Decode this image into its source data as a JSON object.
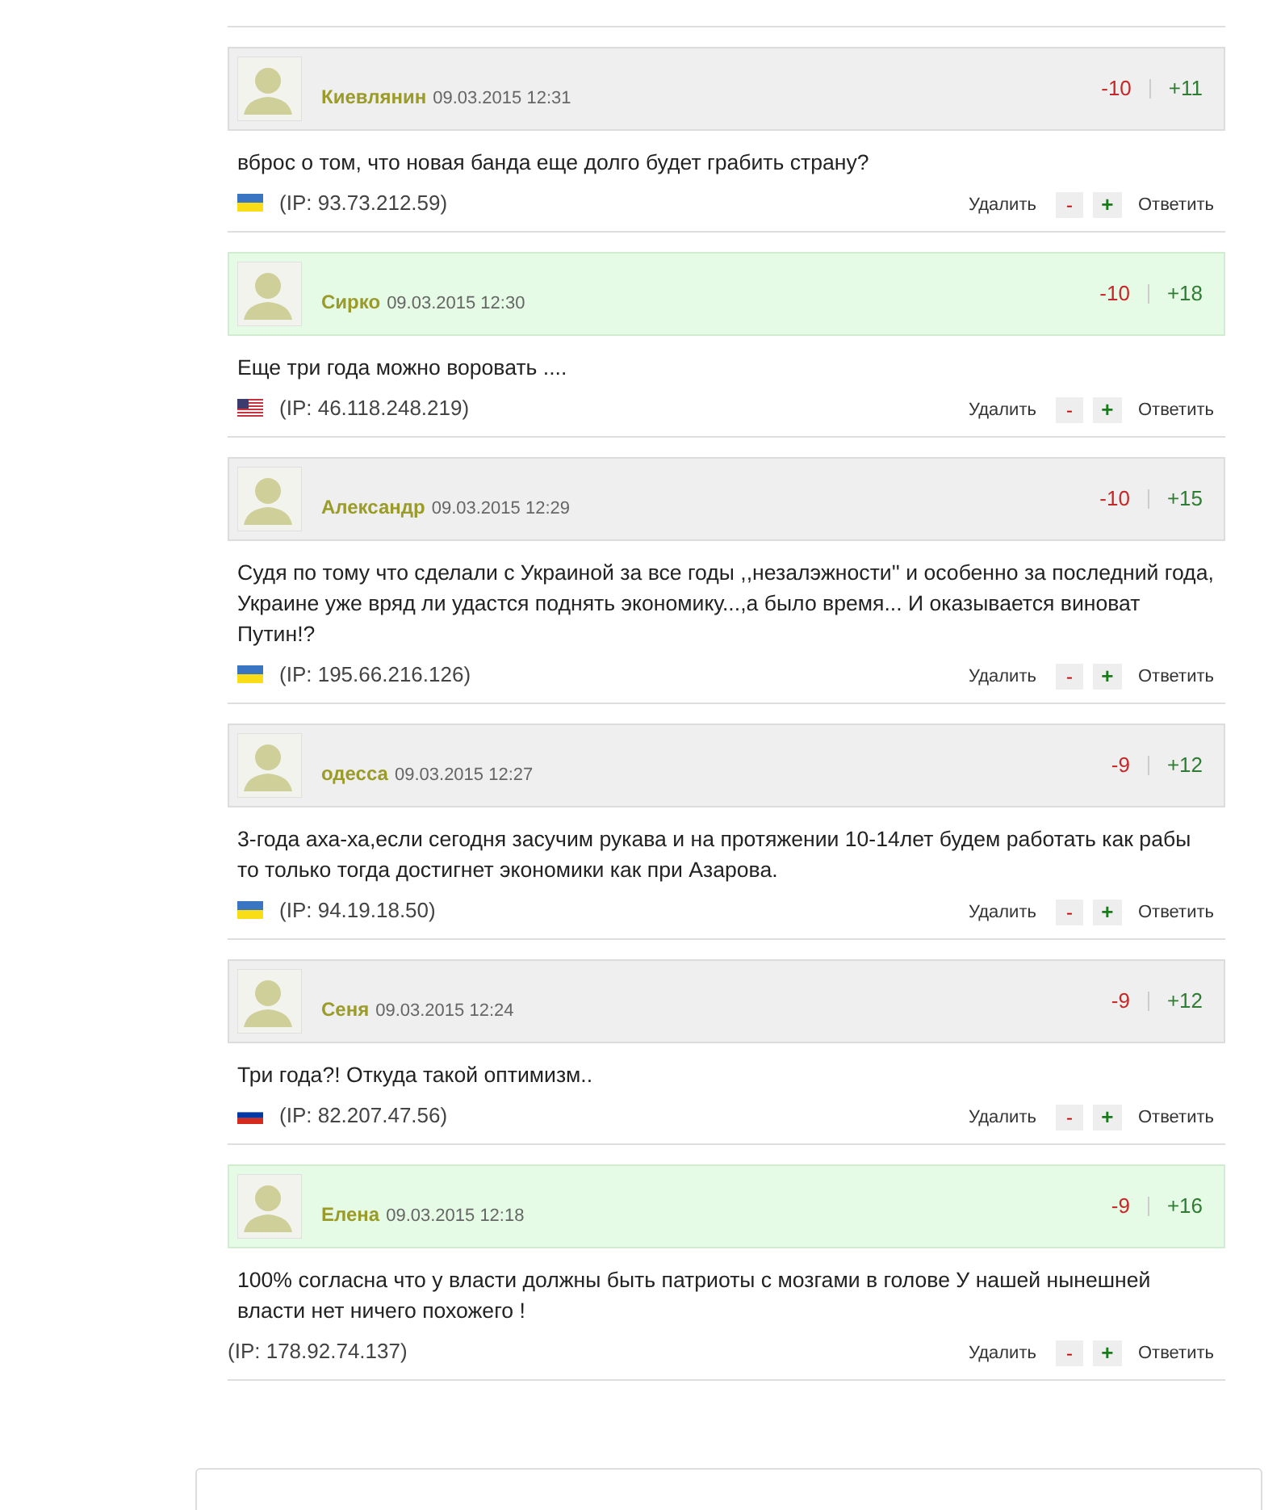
{
  "comments": [
    {
      "name": "Киевлянин",
      "date": "09.03.2015 12:31",
      "down": "-10",
      "up": "+11",
      "highlighted": false,
      "text": "вброс о том, что новая банда еще долго будет грабить страну?",
      "flag": {
        "kind": "ua"
      },
      "ip": "(IP: 93.73.212.59)",
      "delete": "Удалить",
      "minus": "-",
      "plus": "+",
      "reply": "Ответить"
    },
    {
      "name": "Сирко",
      "date": "09.03.2015 12:30",
      "down": "-10",
      "up": "+18",
      "highlighted": true,
      "text": "Еще три года можно воровать ....",
      "flag": {
        "kind": "us"
      },
      "ip": "(IP: 46.118.248.219)",
      "delete": "Удалить",
      "minus": "-",
      "plus": "+",
      "reply": "Ответить"
    },
    {
      "name": "Александр",
      "date": "09.03.2015 12:29",
      "down": "-10",
      "up": "+15",
      "highlighted": false,
      "text": "Судя по тому что сделали с Украиной за все годы ,,незалэжности'' и особенно за последний года, Украине уже вряд ли удастся поднять экономику...,а было время... И оказывается виноват Путин!?",
      "flag": {
        "kind": "ua"
      },
      "ip": "(IP: 195.66.216.126)",
      "delete": "Удалить",
      "minus": "-",
      "plus": "+",
      "reply": "Ответить"
    },
    {
      "name": "одесса",
      "date": "09.03.2015 12:27",
      "down": "-9",
      "up": "+12",
      "highlighted": false,
      "text": "3-года аха-ха,если сегодня засучим рукава и на протяжении 10-14лет будем работать как рабы то только тогда достигнет экономики как при Азарова.",
      "flag": {
        "kind": "ua"
      },
      "ip": "(IP: 94.19.18.50)",
      "delete": "Удалить",
      "minus": "-",
      "plus": "+",
      "reply": "Ответить"
    },
    {
      "name": "Сеня",
      "date": "09.03.2015 12:24",
      "down": "-9",
      "up": "+12",
      "highlighted": false,
      "text": "Три года?! Откуда такой оптимизм..",
      "flag": {
        "kind": "ru"
      },
      "ip": "(IP: 82.207.47.56)",
      "delete": "Удалить",
      "minus": "-",
      "plus": "+",
      "reply": "Ответить"
    },
    {
      "name": "Елена",
      "date": "09.03.2015 12:18",
      "down": "-9",
      "up": "+16",
      "highlighted": true,
      "text": "100% согласна что у власти должны быть патриоты с мозгами в голове У нашей нынешней власти нет ничего похожего !",
      "ip": "(IP: 178.92.74.137)",
      "delete": "Удалить",
      "minus": "-",
      "plus": "+",
      "reply": "Ответить"
    }
  ]
}
